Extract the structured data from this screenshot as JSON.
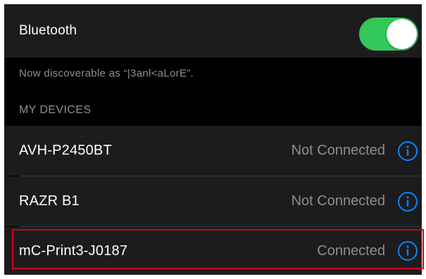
{
  "bluetooth": {
    "label": "Bluetooth",
    "enabled": true,
    "toggle_color": "#34c759"
  },
  "discoverable_text": "Now discoverable as “|3anl<aLorE”.",
  "section_header": "MY DEVICES",
  "devices": [
    {
      "name": "AVH-P2450BT",
      "status": "Not Connected",
      "icon": "info-icon"
    },
    {
      "name": "RAZR B1",
      "status": "Not Connected",
      "icon": "info-icon"
    },
    {
      "name": "mC-Print3-J0187",
      "status": "Connected",
      "icon": "info-icon",
      "highlighted": true
    }
  ],
  "colors": {
    "accent_blue": "#0a84ff",
    "highlight_red": "#d0021b",
    "row_background": "#1c1c1e",
    "secondary_text": "#8e8e93"
  }
}
